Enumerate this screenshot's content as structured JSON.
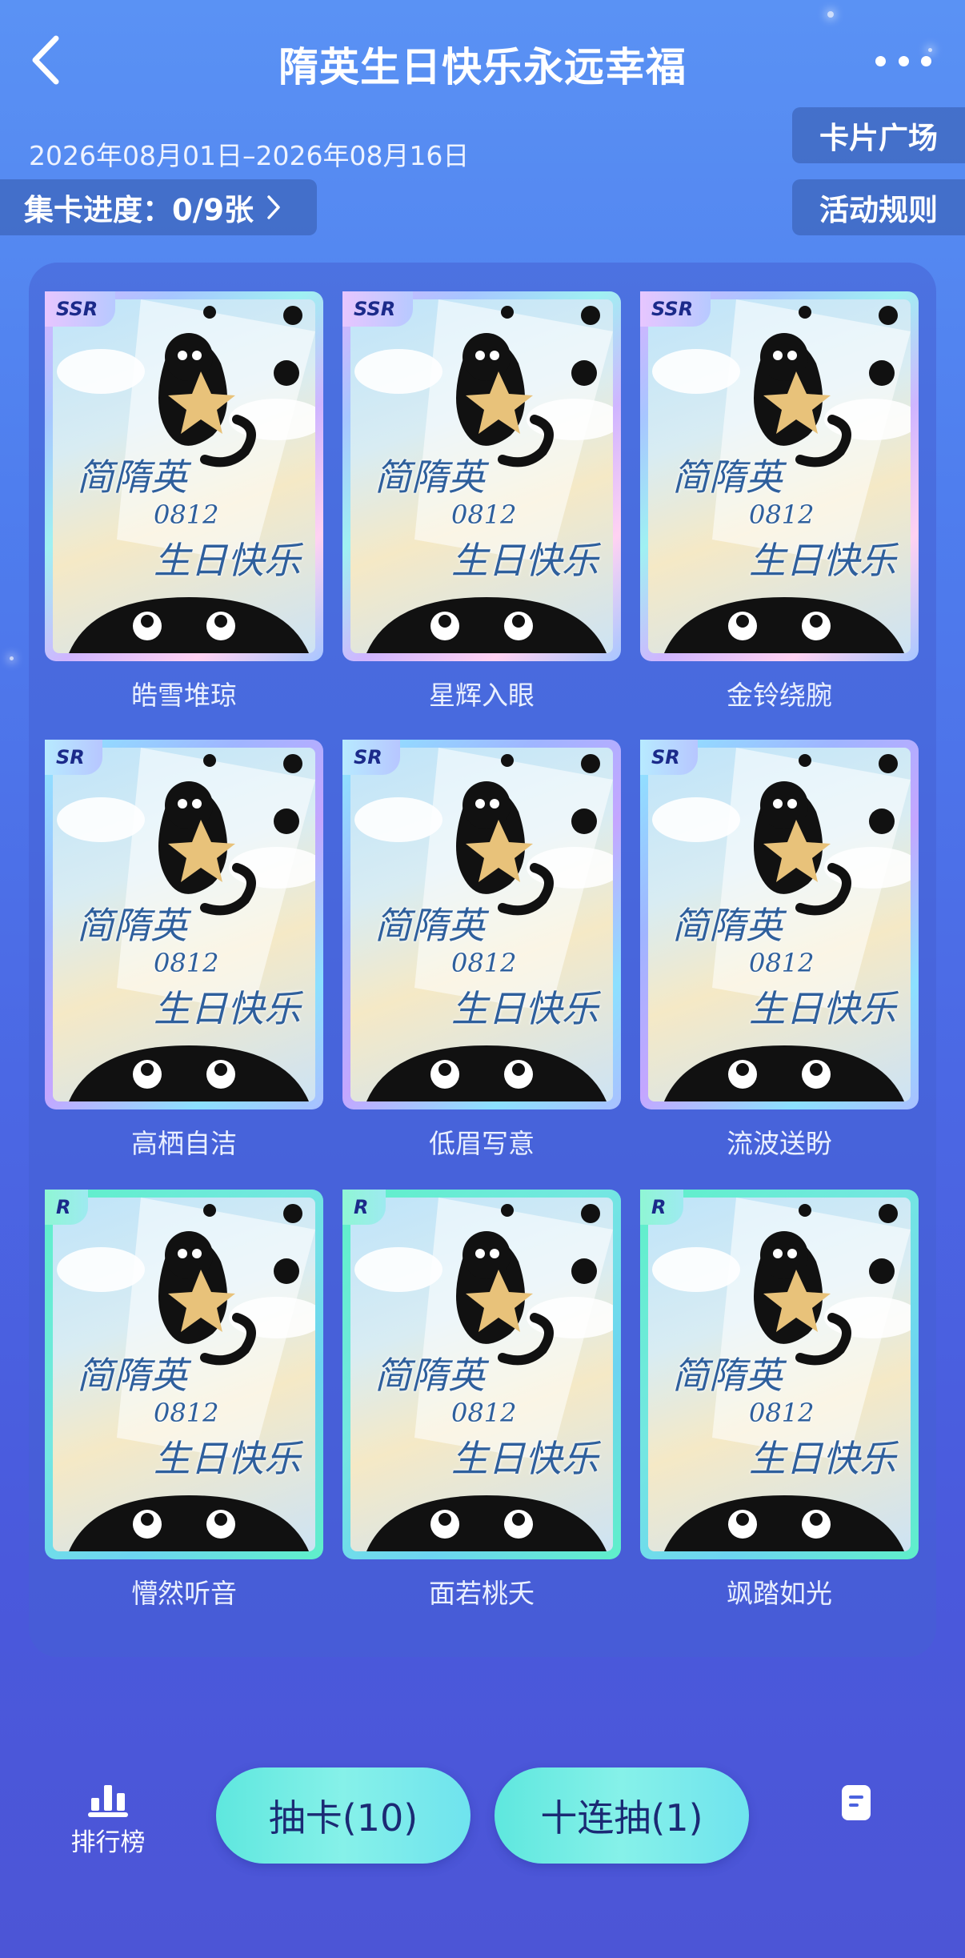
{
  "header": {
    "title": "隋英生日快乐永远幸福",
    "date_range": "2026年08月01日–2026年08月16日",
    "progress": "集卡进度：0/9张",
    "card_plaza": "卡片广场",
    "rules": "活动规则"
  },
  "cards": [
    {
      "rarity": "SSR",
      "name": "皓雪堆琼"
    },
    {
      "rarity": "SSR",
      "name": "星辉入眼"
    },
    {
      "rarity": "SSR",
      "name": "金铃绕腕"
    },
    {
      "rarity": "SR",
      "name": "高栖自洁"
    },
    {
      "rarity": "SR",
      "name": "低眉写意"
    },
    {
      "rarity": "SR",
      "name": "流波送盼"
    },
    {
      "rarity": "R",
      "name": "懵然听音"
    },
    {
      "rarity": "R",
      "name": "面若桃夭"
    },
    {
      "rarity": "R",
      "name": "飒踏如光"
    }
  ],
  "card_art": {
    "line1": "简隋英",
    "line2": "0812",
    "line3": "生日快乐"
  },
  "footer": {
    "ranking": "排行榜",
    "draw": "抽卡(10)",
    "ten_draw": "十连抽(1)"
  },
  "colors": {
    "accent": "#5ee7de",
    "background": "#4f7eee"
  }
}
